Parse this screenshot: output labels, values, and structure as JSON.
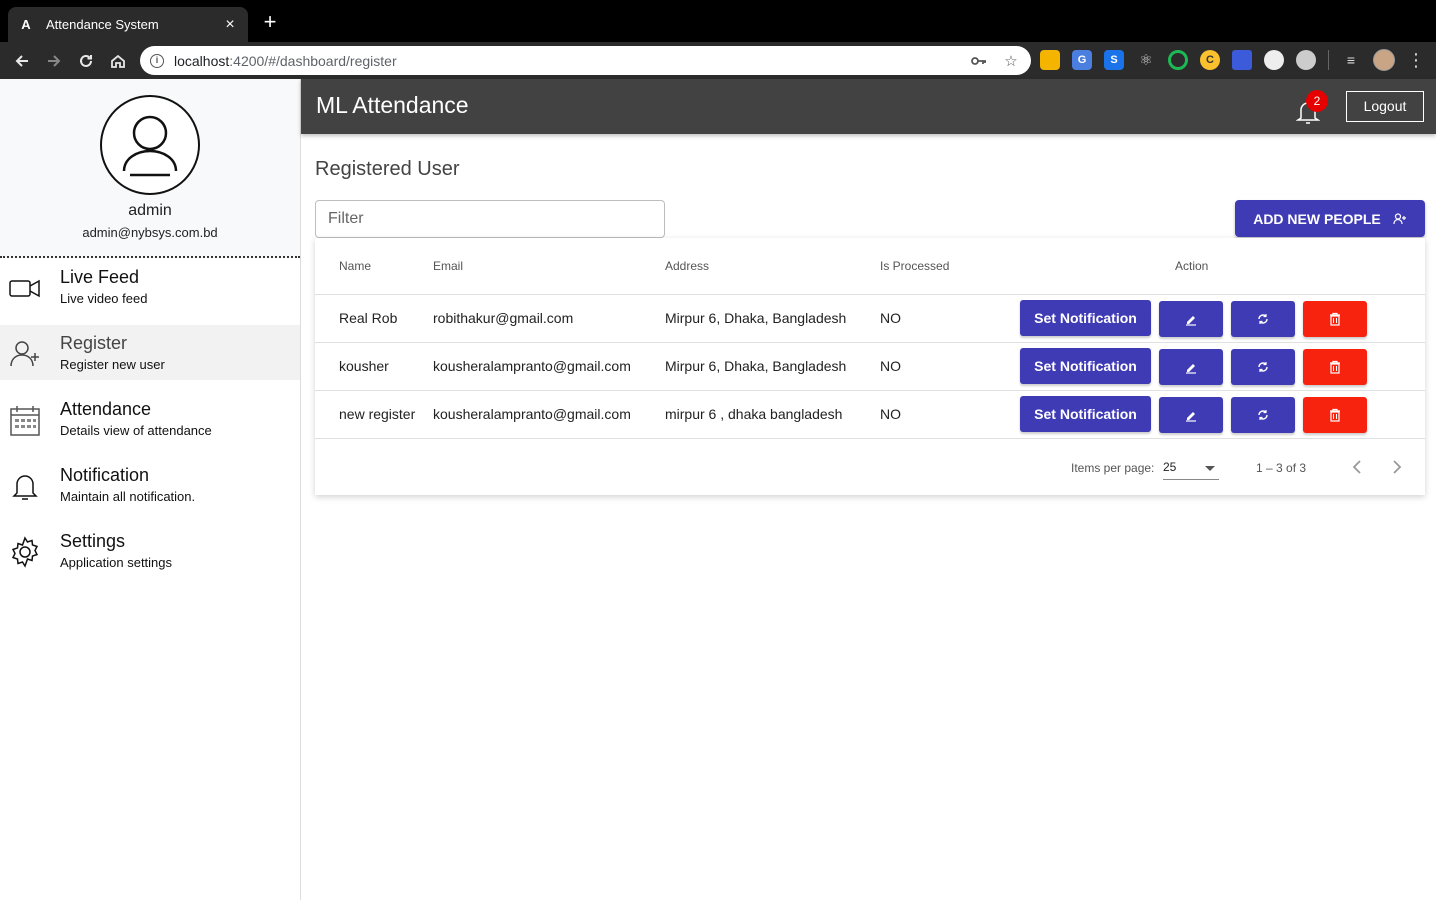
{
  "browser": {
    "tab_title": "Attendance System",
    "new_tab_symbol": "+",
    "close_symbol": "×",
    "url_host": "localhost",
    "url_rest": ":4200/#/dashboard/register"
  },
  "profile": {
    "name": "admin",
    "email": "admin@nybsys.com.bd"
  },
  "sidebar": {
    "items": [
      {
        "title": "Live Feed",
        "subtitle": "Live video feed"
      },
      {
        "title": "Register",
        "subtitle": "Register new user"
      },
      {
        "title": "Attendance",
        "subtitle": "Details view of attendance"
      },
      {
        "title": "Notification",
        "subtitle": "Maintain all notification."
      },
      {
        "title": "Settings",
        "subtitle": "Application settings"
      }
    ]
  },
  "header": {
    "title": "ML Attendance",
    "notification_count": "2",
    "logout_label": "Logout"
  },
  "main": {
    "page_title": "Registered User",
    "filter_placeholder": "Filter",
    "add_button_label": "ADD NEW PEOPLE"
  },
  "table": {
    "columns": [
      "Name",
      "Email",
      "Address",
      "Is Processed",
      "Action"
    ],
    "rows": [
      {
        "name": "Real Rob",
        "email": "robithakur@gmail.com",
        "address": "Mirpur 6, Dhaka, Bangladesh",
        "processed": "NO",
        "notify_label": "Set Notification"
      },
      {
        "name": "kousher",
        "email": "kousheralampranto@gmail.com",
        "address": "Mirpur 6, Dhaka, Bangladesh",
        "processed": "NO",
        "notify_label": "Set Notification"
      },
      {
        "name": "new register",
        "email": "kousheralampranto@gmail.com",
        "address": "mirpur 6 , dhaka bangladesh",
        "processed": "NO",
        "notify_label": "Set Notification"
      }
    ]
  },
  "paginator": {
    "items_per_page_label": "Items per page:",
    "page_size": "25",
    "range": "1 – 3 of 3"
  },
  "colors": {
    "primary": "#3f3bb5",
    "danger": "#f8230e",
    "appbar": "#424242",
    "badge": "#e60000"
  }
}
